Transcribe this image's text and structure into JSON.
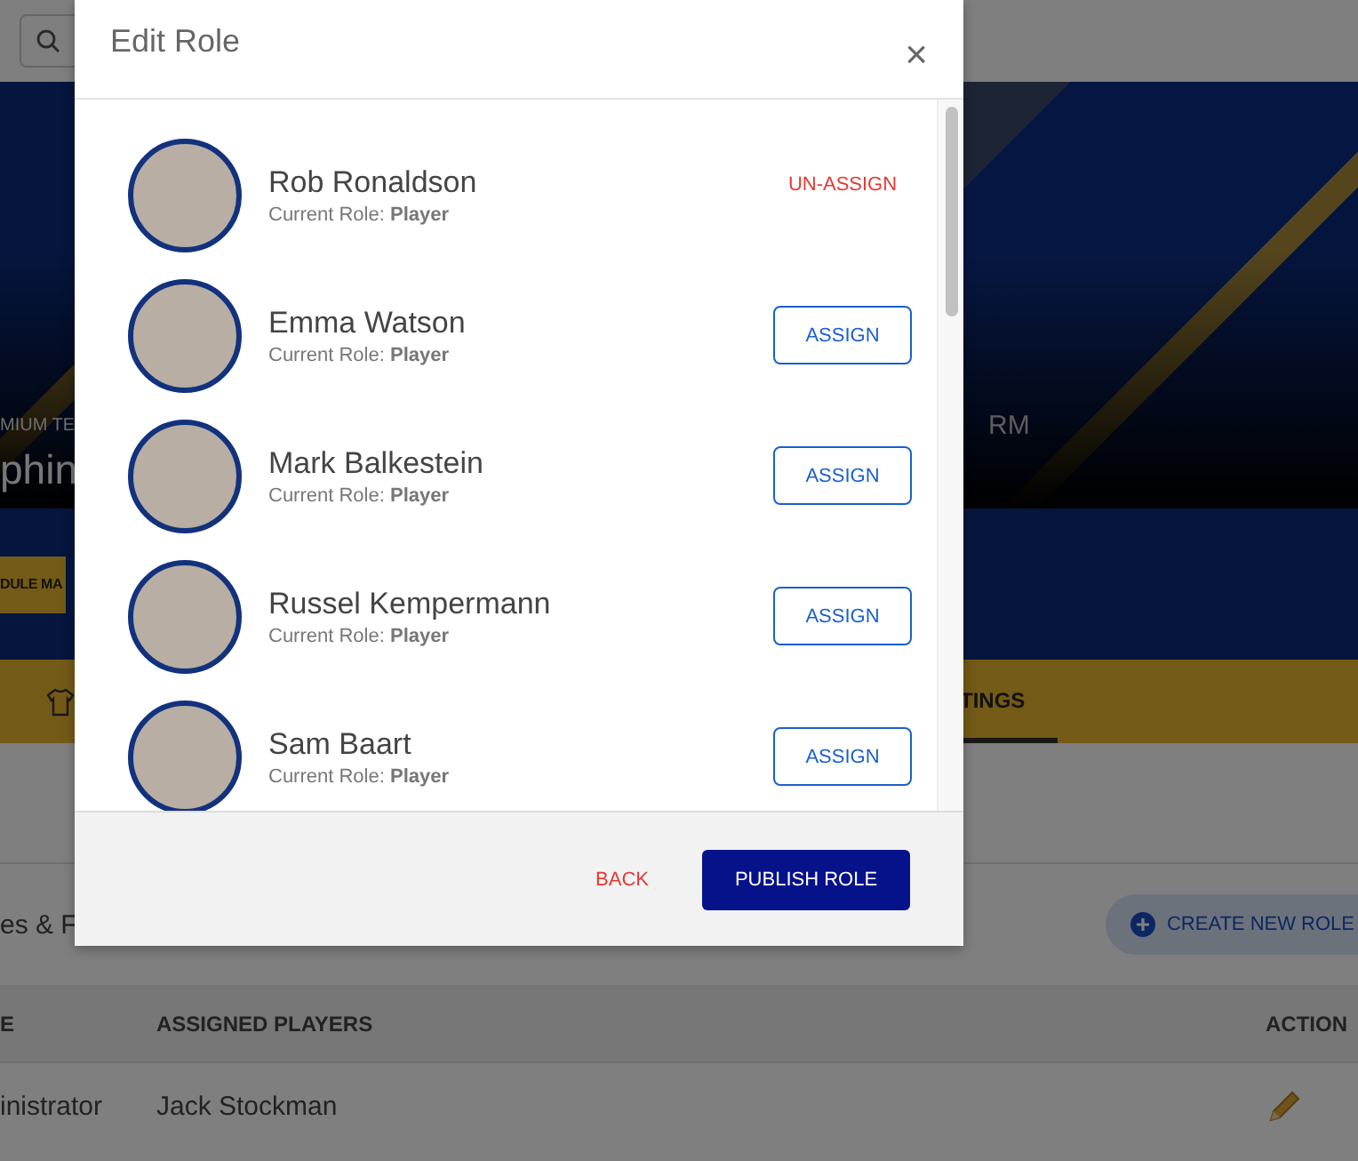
{
  "background": {
    "hero_kicker": "MIUM TE",
    "hero_title": "phin",
    "hero_right": "RM",
    "schedule_button": "DULE MA",
    "tab_label": "TINGS",
    "section_title": "es & F",
    "create_button": "CREATE NEW ROLE",
    "table": {
      "columns": [
        "E",
        "ASSIGNED PLAYERS",
        "ACTION"
      ],
      "rows": [
        {
          "role": "inistrator",
          "players": "Jack Stockman"
        }
      ]
    }
  },
  "modal": {
    "title": "Edit Role",
    "close": "×",
    "members": [
      {
        "name": "Rob Ronaldson",
        "role": "Current Role: **Player**",
        "action": {
          "kind": "unassign",
          "label": "UN-ASSIGN"
        }
      },
      {
        "name": "Emma Watson",
        "role": "Current Role: **Player**",
        "action": {
          "kind": "assign",
          "label": "ASSIGN"
        }
      },
      {
        "name": "Mark Balkestein",
        "role": "Current Role: **Player**",
        "action": {
          "kind": "assign",
          "label": "ASSIGN"
        }
      },
      {
        "name": "Russel Kempermann",
        "role": "Current Role: **Player**",
        "action": {
          "kind": "assign",
          "label": "ASSIGN"
        }
      },
      {
        "name": "Sam Baart",
        "role": "Current Role: **Player**",
        "action": {
          "kind": "assign",
          "label": "ASSIGN"
        }
      }
    ],
    "back": "BACK",
    "publish": "PUBLISH ROLE"
  }
}
